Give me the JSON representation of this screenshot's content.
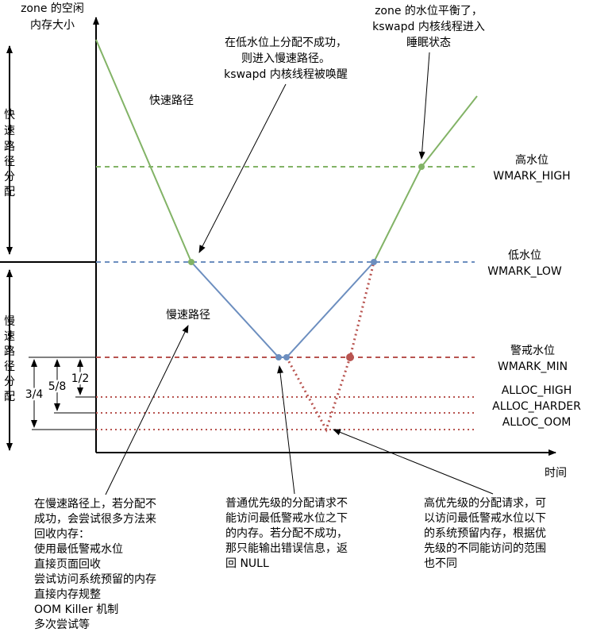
{
  "y_axis_label": [
    "zone 的空闲",
    "内存大小"
  ],
  "x_axis_label": "时间",
  "fast_path_side": [
    "快",
    "速",
    "路",
    "径",
    "分",
    "配"
  ],
  "slow_path_side": [
    "慢",
    "速",
    "路",
    "径",
    "分",
    "配"
  ],
  "fractions": {
    "three_quarters": "3/4",
    "five_eighths": "5/8",
    "half": "1/2"
  },
  "watermarks": {
    "high": [
      "高水位",
      "WMARK_HIGH"
    ],
    "low": [
      "低水位",
      "WMARK_LOW"
    ],
    "min": [
      "警戒水位",
      "WMARK_MIN"
    ],
    "alloc": [
      "ALLOC_HIGH",
      "ALLOC_HARDER",
      "ALLOC_OOM"
    ]
  },
  "labels": {
    "fast_path": "快速路径",
    "slow_path": "慢速路径"
  },
  "annotations": {
    "wake": [
      "在低水位上分配不成功，",
      "则进入慢速路径。",
      "kswapd 内核线程被唤醒"
    ],
    "sleep": [
      "zone 的水位平衡了，",
      "kswapd 内核线程进入",
      "睡眠状态"
    ],
    "slow_path_notes": [
      "在慢速路径上，若分配不",
      "成功，会尝试很多方法来",
      "回收内存：",
      "使用最低警戒水位",
      "直接页面回收",
      "尝试访问系统预留的内存",
      "直接内存规整",
      "OOM Killer 机制",
      "多次尝试等"
    ],
    "normal_priority": [
      "普通优先级的分配请求不",
      "能访问最低警戒水位之下",
      "的内存。若分配不成功，",
      "那只能输出错误信息，返",
      "回 NULL"
    ],
    "high_priority": [
      "高优先级的分配请求，可",
      "以访问最低警戒水位以下",
      "的系统预留内存，根据优",
      "先级的不同能访问的范围",
      "也不同"
    ]
  },
  "colors": {
    "green": "#82b366",
    "blue": "#6c8ebf",
    "red": "#b85450"
  }
}
